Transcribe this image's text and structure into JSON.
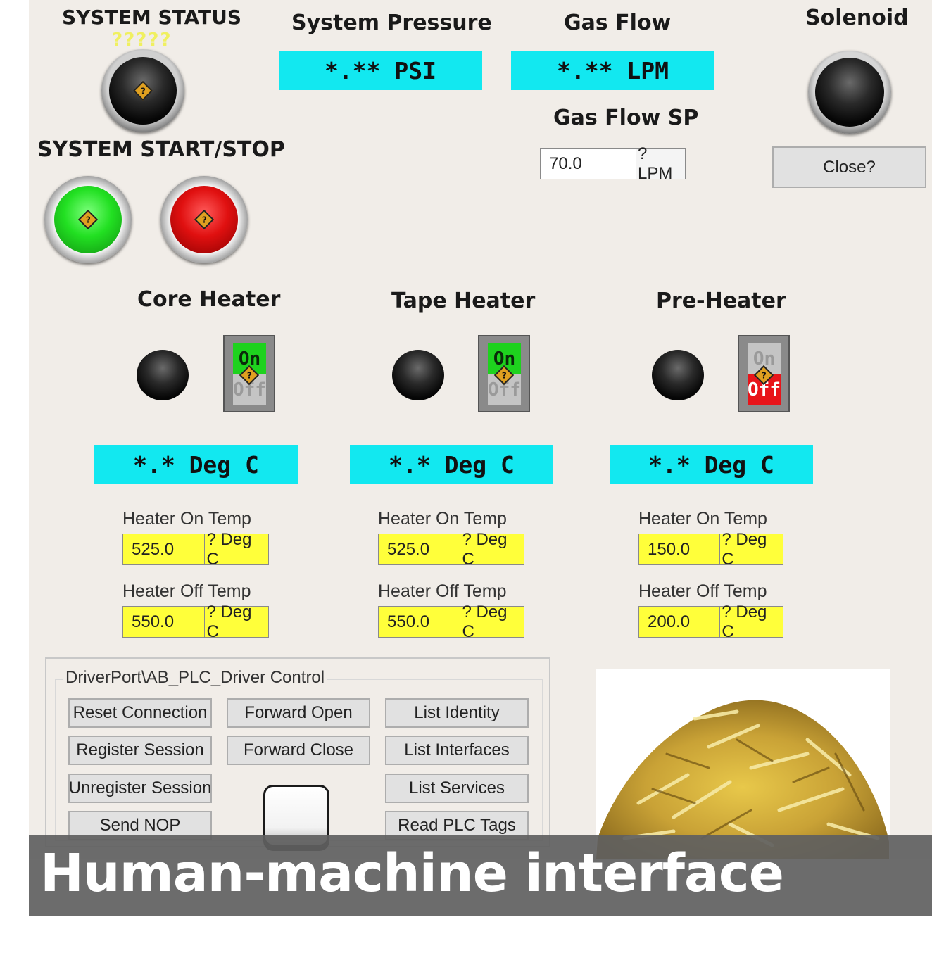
{
  "system_status": {
    "title": "SYSTEM STATUS",
    "indicator_text": "?????",
    "lamp_glyph": "?"
  },
  "system_start_stop": {
    "title": "SYSTEM START/STOP",
    "start_glyph": "?",
    "stop_glyph": "?",
    "start_color": "#22e022",
    "stop_color": "#e01010"
  },
  "pressure": {
    "title": "System Pressure",
    "display": "*.** PSI"
  },
  "gas_flow": {
    "title": "Gas Flow",
    "display": "*.** LPM",
    "sp_title": "Gas Flow SP",
    "sp_value": "70.0",
    "sp_unit": "? LPM"
  },
  "solenoid": {
    "title": "Solenoid",
    "button_label": "Close?"
  },
  "heaters": [
    {
      "title": "Core Heater",
      "switch_on": "On",
      "switch_off": "Off",
      "switch_state": "on",
      "display": "*.* Deg C",
      "on_temp_label": "Heater On Temp",
      "on_temp": "525.0",
      "off_temp_label": "Heater Off Temp",
      "off_temp": "550.0",
      "unit": "? Deg C"
    },
    {
      "title": "Tape Heater",
      "switch_on": "On",
      "switch_off": "Off",
      "switch_state": "on",
      "display": "*.* Deg C",
      "on_temp_label": "Heater On Temp",
      "on_temp": "525.0",
      "off_temp_label": "Heater Off Temp",
      "off_temp": "550.0",
      "unit": "? Deg C"
    },
    {
      "title": "Pre-Heater",
      "switch_on": "On",
      "switch_off": "Off",
      "switch_state": "off",
      "display": "*.* Deg C",
      "on_temp_label": "Heater On Temp",
      "on_temp": "150.0",
      "off_temp_label": "Heater Off Temp",
      "off_temp": "200.0",
      "unit": "? Deg C"
    }
  ],
  "driver": {
    "title": "DriverPort\\AB_PLC_Driver Control",
    "buttons": [
      "Reset Connection",
      "Forward Open",
      "List Identity",
      "Register Session",
      "Forward Close",
      "List Interfaces",
      "Unregister Session",
      "List Services",
      "Send NOP",
      "Read PLC Tags"
    ]
  },
  "colors": {
    "display_bg": "#12e8f0",
    "setpoint_bg": "#ffff3a",
    "panel_bg": "#f1ede8",
    "switch_on": "#1ed21e",
    "switch_off": "#e8141a"
  },
  "photo": {
    "subject": "wood-chips-image"
  },
  "banner": {
    "text": "Human-machine interface"
  }
}
